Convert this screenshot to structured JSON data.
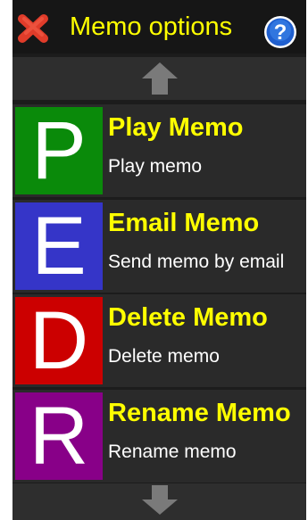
{
  "header": {
    "title": "Memo options",
    "close_icon": "close-x-icon",
    "help_icon": "help-question-icon"
  },
  "scroll": {
    "up_icon": "arrow-up-icon",
    "down_icon": "arrow-down-icon"
  },
  "items": [
    {
      "letter": "P",
      "title": "Play Memo",
      "subtitle": "Play memo",
      "color": "#0a8a0a"
    },
    {
      "letter": "E",
      "title": "Email Memo",
      "subtitle": "Send memo by email",
      "color": "#3535c8"
    },
    {
      "letter": "D",
      "title": "Delete Memo",
      "subtitle": "Delete memo",
      "color": "#cc0000"
    },
    {
      "letter": "R",
      "title": "Rename Memo",
      "subtitle": "Rename memo",
      "color": "#880088"
    }
  ],
  "colors": {
    "accent": "#ffff00",
    "background": "#1c1c1c",
    "row": "#2a2a2a"
  }
}
